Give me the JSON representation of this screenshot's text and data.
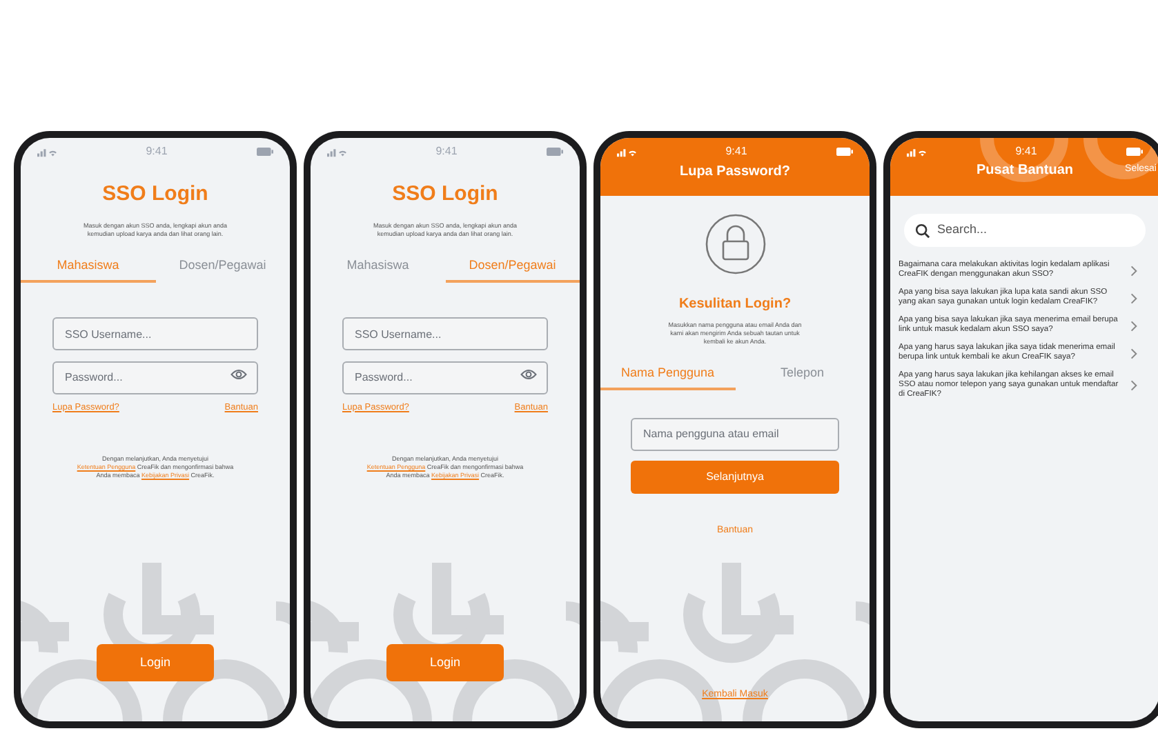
{
  "screens": [
    {
      "kind": "login",
      "time": "9:41",
      "title": "SSO Login",
      "subtitle": "Masuk dengan akun SSO anda, lengkapi akun anda kemudian upload karya anda dan lihat orang lain.",
      "tabs": [
        {
          "label": "Mahasiswa",
          "selected": true
        },
        {
          "label": "Dosen/Pegawai",
          "selected": false
        }
      ],
      "username": {
        "placeholder": "SSO Username..."
      },
      "password": {
        "placeholder": "Password..."
      },
      "forgot_link": "Lupa Password?",
      "help_link": "Bantuan",
      "terms": [
        {
          "kind": "text",
          "text": "Dengan melanjutkan, Anda menyetujui "
        },
        {
          "kind": "link",
          "text": "Ketentuan Pengguna"
        },
        {
          "kind": "text",
          "text": " CreaFik dan mengonfirmasi bahwa Anda membaca "
        },
        {
          "kind": "link",
          "text": "Kebijakan Privasi"
        },
        {
          "kind": "text",
          "text": " CreaFik."
        }
      ],
      "button": "Login"
    },
    {
      "kind": "login",
      "time": "9:41",
      "title": "SSO Login",
      "subtitle": "Masuk dengan akun SSO anda, lengkapi akun anda kemudian upload karya anda dan lihat orang lain.",
      "tabs": [
        {
          "label": "Mahasiswa",
          "selected": false
        },
        {
          "label": "Dosen/Pegawai",
          "selected": true
        }
      ],
      "username": {
        "placeholder": "SSO Username..."
      },
      "password": {
        "placeholder": "Password..."
      },
      "forgot_link": "Lupa Password?",
      "help_link": "Bantuan",
      "terms": [
        {
          "kind": "text",
          "text": "Dengan melanjutkan, Anda menyetujui "
        },
        {
          "kind": "link",
          "text": "Ketentuan Pengguna"
        },
        {
          "kind": "text",
          "text": " CreaFik dan mengonfirmasi bahwa Anda membaca "
        },
        {
          "kind": "link",
          "text": "Kebijakan Privasi"
        },
        {
          "kind": "text",
          "text": " CreaFik."
        }
      ],
      "button": "Login"
    },
    {
      "kind": "forgot",
      "time": "9:41",
      "title": "Lupa Password?",
      "heading": "Kesulitan Login?",
      "description": "Masukkan nama pengguna atau email Anda dan kami akan mengirim Anda sebuah tautan untuk kembali ke akun Anda.",
      "tabs": [
        {
          "label": "Nama Pengguna",
          "selected": true
        },
        {
          "label": "Telepon",
          "selected": false
        }
      ],
      "field": {
        "placeholder": "Nama pengguna atau email"
      },
      "button": "Selanjutnya",
      "help_link": "Bantuan",
      "back_link": "Kembali Masuk"
    },
    {
      "kind": "help",
      "time": "9:41",
      "title": "Pusat Bantuan",
      "done": "Selesai",
      "search": {
        "placeholder": "Search..."
      },
      "questions": [
        "Bagaimana cara melakukan aktivitas login kedalam aplikasi CreaFIK dengan menggunakan akun SSO?",
        "Apa yang bisa saya lakukan jika lupa kata sandi akun SSO yang akan saya gunakan untuk login kedalam CreaFIK?",
        "Apa yang bisa saya lakukan jika saya menerima email berupa link untuk masuk kedalam akun SSO saya?",
        "Apa yang harus saya lakukan jika saya tidak menerima email berupa link untuk kembali ke akun CreaFIK saya?",
        "Apa yang harus saya lakukan jika kehilangan akses ke email SSO atau nomor telepon yang saya gunakan untuk mendaftar di CreaFIK?"
      ]
    }
  ]
}
